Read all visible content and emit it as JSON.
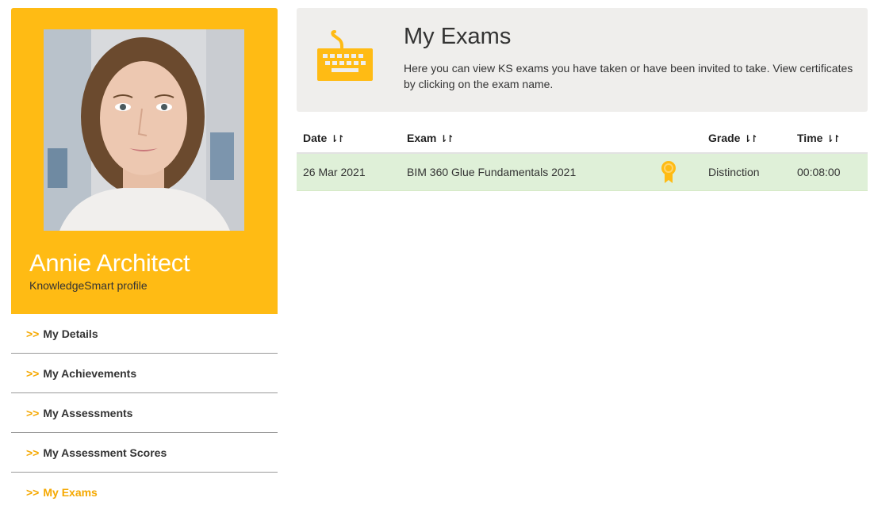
{
  "profile": {
    "name": "Annie Architect",
    "subtitle": "KnowledgeSmart profile"
  },
  "nav": {
    "arrow": ">>",
    "items": [
      {
        "label": "My Details"
      },
      {
        "label": "My Achievements"
      },
      {
        "label": "My Assessments"
      },
      {
        "label": "My Assessment Scores"
      },
      {
        "label": "My Exams"
      }
    ],
    "active_index": 4
  },
  "header": {
    "title": "My Exams",
    "description": "Here you can view KS exams you have taken or have been invited to take. View certificates by clicking on the exam name.",
    "icon": "keyboard-icon"
  },
  "table": {
    "columns": [
      {
        "label": "Date",
        "sort": "⇂↾"
      },
      {
        "label": "Exam",
        "sort": "⇂↾"
      },
      {
        "label": ""
      },
      {
        "label": "Grade",
        "sort": "⇂↾"
      },
      {
        "label": "Time",
        "sort": "⇂↾"
      }
    ],
    "rows": [
      {
        "date": "26 Mar 2021",
        "exam": "BIM 360 Glue Fundamentals 2021",
        "icon": "award-ribbon-icon",
        "grade": "Distinction",
        "time": "00:08:00"
      }
    ]
  },
  "colors": {
    "accent": "#ffbb14",
    "accent_text": "#f5a800",
    "row_success": "#dff0d8",
    "panel": "#efeeec"
  }
}
